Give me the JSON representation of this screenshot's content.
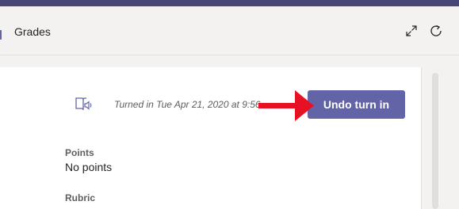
{
  "header": {
    "title": "Grades",
    "icons": [
      "expand-icon",
      "refresh-icon"
    ]
  },
  "submission": {
    "reader_icon": "immersive-reader-icon",
    "status_text": "Turned in Tue Apr 21, 2020 at 9:56",
    "undo_label": "Undo turn in"
  },
  "annotation": {
    "arrow_color": "#e81123"
  },
  "points": {
    "label": "Points",
    "value": "No points"
  },
  "rubric": {
    "label": "Rubric"
  },
  "colors": {
    "accent": "#6264a7",
    "top_bar": "#464775",
    "background": "#f3f2f1"
  }
}
